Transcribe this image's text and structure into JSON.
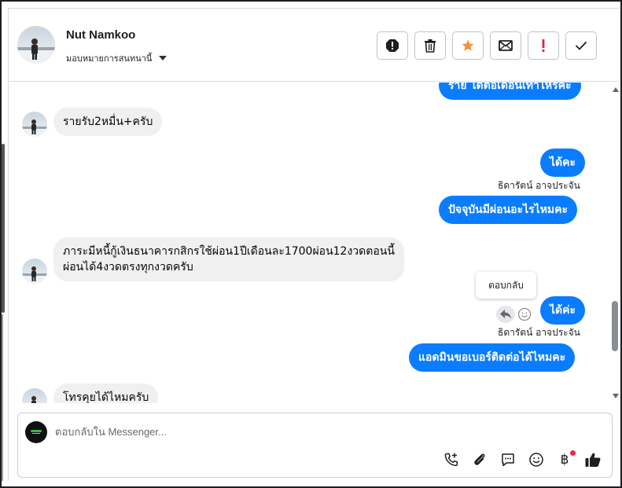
{
  "header": {
    "name": "Nut Namkoo",
    "assign_label": "มอบหมายการสนทนานี้",
    "actions": [
      {
        "id": "spam",
        "icon": "alert-octagon-icon"
      },
      {
        "id": "delete",
        "icon": "trash-icon"
      },
      {
        "id": "star",
        "icon": "star-icon",
        "color": "#f7923b"
      },
      {
        "id": "unread",
        "icon": "envelope-icon"
      },
      {
        "id": "follow-up",
        "icon": "exclamation-icon",
        "color": "#e41e3f"
      },
      {
        "id": "done",
        "icon": "check-icon"
      }
    ]
  },
  "messages": {
    "partial_top": "ราย ได้ต่อเดือนเท่าไหร่คะ",
    "m1": "รายรับ2หมื่น+ครับ",
    "m2": "ได้คะ",
    "m2_sender": "ธิดารัตน์ อาจประจัน",
    "m3": "ปัจจุบันมีผ่อนอะไรไหมคะ",
    "m4_line1": "ภาระมีหนี้กู้เงินธนาคารกสิกรใช้ผ่อน1ปีเดือนละ1700ผ่อน12งวดตอนนี้",
    "m4_line2": "ผ่อนได้4งวดตรงทุกงวดครับ",
    "m5": "ได้ค่ะ",
    "m5_sender": "ธิดารัตน์ อาจประจัน",
    "m6": "แอดมินขอเบอร์ติดต่อได้ไหมคะ",
    "m7": "โทรคุยได้ไหมครับ"
  },
  "tooltip": "ตอบกลับ",
  "composer": {
    "placeholder": "ตอบกลับใน Messenger...",
    "tools": [
      "call-add-icon",
      "paperclip-icon",
      "saved-reply-icon",
      "emoji-icon",
      "baht-icon",
      "like-icon"
    ],
    "baht_symbol": "฿"
  },
  "colors": {
    "outgoing_bubble": "#0a7cff",
    "incoming_bubble": "#f0f0f0",
    "star": "#f7923b",
    "alert": "#e41e3f"
  }
}
